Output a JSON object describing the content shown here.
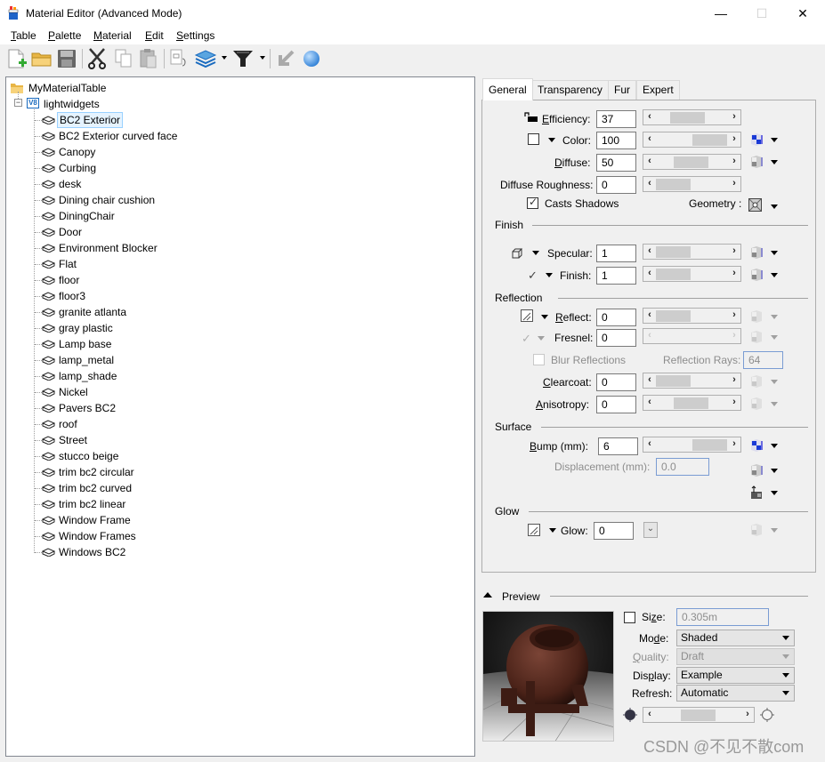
{
  "window": {
    "title": "Material Editor (Advanced Mode)",
    "controls": {
      "minimize": "—",
      "maximize": "☐",
      "close": "✕"
    }
  },
  "menu": [
    "Table",
    "Palette",
    "Material",
    "Edit",
    "Settings"
  ],
  "menu_mnemonics": [
    "T",
    "P",
    "M",
    "E",
    "S"
  ],
  "toolbar": {
    "icons": [
      "new-table-icon",
      "open-folder-icon",
      "save-icon",
      "cut-icon",
      "copy-icon",
      "paste-icon",
      "copy-material-icon",
      "palette-layers-icon",
      "filter-icon",
      "assign-material-icon",
      "render-sphere-icon"
    ]
  },
  "tree": {
    "root": "MyMaterialTable",
    "palette": "lightwidgets",
    "selected": "BC2 Exterior",
    "materials": [
      "BC2 Exterior",
      "BC2 Exterior curved face",
      "Canopy",
      "Curbing",
      "desk",
      "Dining chair cushion",
      "DiningChair",
      "Door",
      "Environment Blocker",
      "Flat",
      "floor",
      "floor3",
      "granite atlanta",
      "gray plastic",
      "Lamp base",
      "lamp_metal",
      "lamp_shade",
      "Nickel",
      "Pavers BC2",
      "roof",
      "Street",
      "stucco beige",
      "trim bc2 circular",
      "trim bc2 curved",
      "trim bc2 linear",
      "Window Frame",
      "Window Frames",
      "Windows BC2"
    ]
  },
  "tabs": [
    "General",
    "Transparency",
    "Fur",
    "Expert"
  ],
  "active_tab": "General",
  "general": {
    "efficiency": {
      "label": "Efficiency:",
      "value": "37"
    },
    "color": {
      "label": "Color:",
      "value": "100"
    },
    "diffuse": {
      "label": "Diffuse:",
      "value": "50"
    },
    "diffuse_roughness": {
      "label": "Diffuse Roughness:",
      "value": "0"
    },
    "casts_shadows": {
      "label": "Casts Shadows",
      "checked": true
    },
    "geometry_label": "Geometry :",
    "finish_section": "Finish",
    "specular": {
      "label": "Specular:",
      "value": "1"
    },
    "finish": {
      "label": "Finish:",
      "value": "1"
    },
    "reflection_section": "Reflection",
    "reflect": {
      "label": "Reflect:",
      "value": "0"
    },
    "fresnel": {
      "label": "Fresnel:",
      "value": "0"
    },
    "blur_reflections": {
      "label": "Blur Reflections",
      "checked": false
    },
    "reflection_rays": {
      "label": "Reflection Rays:",
      "value": "64"
    },
    "clearcoat": {
      "label": "Clearcoat:",
      "value": "0"
    },
    "anisotropy": {
      "label": "Anisotropy:",
      "value": "0"
    },
    "surface_section": "Surface",
    "bump": {
      "label": "Bump (mm):",
      "value": "6"
    },
    "displacement": {
      "label": "Displacement (mm):",
      "value": "0.0"
    },
    "glow_section": "Glow",
    "glow": {
      "label": "Glow:",
      "value": "0"
    }
  },
  "preview": {
    "title": "Preview",
    "size": {
      "label": "Size:",
      "value": "0.305m",
      "checked": false
    },
    "mode": {
      "label": "Mode:",
      "value": "Shaded"
    },
    "quality": {
      "label": "Quality:",
      "value": "Draft"
    },
    "display": {
      "label": "Display:",
      "value": "Example"
    },
    "refresh": {
      "label": "Refresh:",
      "value": "Automatic"
    }
  },
  "watermark": "CSDN @不见不散com"
}
